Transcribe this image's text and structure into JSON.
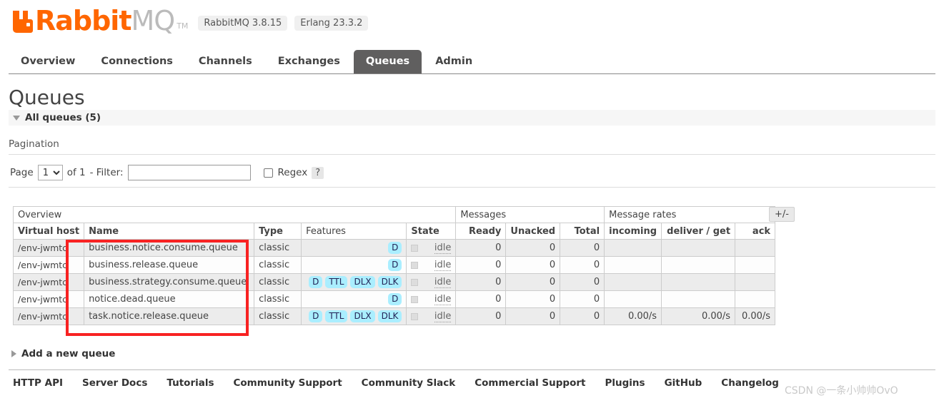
{
  "brand": {
    "name_primary": "Rabbit",
    "name_secondary": "MQ",
    "tm": "TM",
    "version_badges": [
      "RabbitMQ 3.8.15",
      "Erlang 23.3.2"
    ],
    "accent_color": "#ff6600",
    "secondary_color": "#bbbbbb"
  },
  "nav": {
    "tabs": [
      {
        "label": "Overview",
        "active": false
      },
      {
        "label": "Connections",
        "active": false
      },
      {
        "label": "Channels",
        "active": false
      },
      {
        "label": "Exchanges",
        "active": false
      },
      {
        "label": "Queues",
        "active": true
      },
      {
        "label": "Admin",
        "active": false
      }
    ],
    "active_tab_bg": "#605f5f"
  },
  "page": {
    "title": "Queues",
    "section_label": "All queues (5)"
  },
  "pagination": {
    "heading": "Pagination",
    "page_label": "Page",
    "page_value": "1",
    "page_options": [
      "1"
    ],
    "of_label": "of 1",
    "filter_label": "- Filter:",
    "filter_value": "",
    "filter_placeholder": "",
    "regex_label": "Regex",
    "regex_checked": false,
    "help_label": "?"
  },
  "table": {
    "group_headers": [
      {
        "label": "Overview",
        "span": 5
      },
      {
        "label": "Messages",
        "span": 3
      },
      {
        "label": "Message rates",
        "span": 3
      }
    ],
    "columns": [
      {
        "label": "Virtual host",
        "bold": true,
        "align": "left"
      },
      {
        "label": "Name",
        "bold": true,
        "align": "left"
      },
      {
        "label": "Type",
        "bold": true,
        "align": "left"
      },
      {
        "label": "Features",
        "bold": false,
        "align": "left"
      },
      {
        "label": "State",
        "bold": true,
        "align": "left"
      },
      {
        "label": "Ready",
        "bold": true,
        "align": "right"
      },
      {
        "label": "Unacked",
        "bold": true,
        "align": "right"
      },
      {
        "label": "Total",
        "bold": true,
        "align": "right"
      },
      {
        "label": "incoming",
        "bold": true,
        "align": "right"
      },
      {
        "label": "deliver / get",
        "bold": true,
        "align": "right"
      },
      {
        "label": "ack",
        "bold": true,
        "align": "right"
      }
    ],
    "toggle_columns_label": "+/-",
    "rows": [
      {
        "vhost": "/env-jwmtc",
        "name": "business.notice.consume.queue",
        "type": "classic",
        "features": [
          "D"
        ],
        "state": "idle",
        "ready": "0",
        "unacked": "0",
        "total": "0",
        "incoming": "",
        "deliver_get": "",
        "ack": ""
      },
      {
        "vhost": "/env-jwmtc",
        "name": "business.release.queue",
        "type": "classic",
        "features": [
          "D"
        ],
        "state": "idle",
        "ready": "0",
        "unacked": "0",
        "total": "0",
        "incoming": "",
        "deliver_get": "",
        "ack": ""
      },
      {
        "vhost": "/env-jwmtc",
        "name": "business.strategy.consume.queue",
        "type": "classic",
        "features": [
          "D",
          "TTL",
          "DLX",
          "DLK"
        ],
        "state": "idle",
        "ready": "0",
        "unacked": "0",
        "total": "0",
        "incoming": "",
        "deliver_get": "",
        "ack": ""
      },
      {
        "vhost": "/env-jwmtc",
        "name": "notice.dead.queue",
        "type": "classic",
        "features": [
          "D"
        ],
        "state": "idle",
        "ready": "0",
        "unacked": "0",
        "total": "0",
        "incoming": "",
        "deliver_get": "",
        "ack": ""
      },
      {
        "vhost": "/env-jwmtc",
        "name": "task.notice.release.queue",
        "type": "classic",
        "features": [
          "D",
          "TTL",
          "DLX",
          "DLK"
        ],
        "state": "idle",
        "ready": "0",
        "unacked": "0",
        "total": "0",
        "incoming": "0.00/s",
        "deliver_get": "0.00/s",
        "ack": "0.00/s"
      }
    ],
    "feature_pill_color": "#aaeeff"
  },
  "annotation": {
    "highlight_color": "#f82222"
  },
  "add_queue": {
    "label": "Add a new queue"
  },
  "footer": {
    "links": [
      "HTTP API",
      "Server Docs",
      "Tutorials",
      "Community Support",
      "Community Slack",
      "Commercial Support",
      "Plugins",
      "GitHub",
      "Changelog"
    ]
  },
  "watermark": {
    "text": "CSDN @一条小帅帅OvO"
  }
}
